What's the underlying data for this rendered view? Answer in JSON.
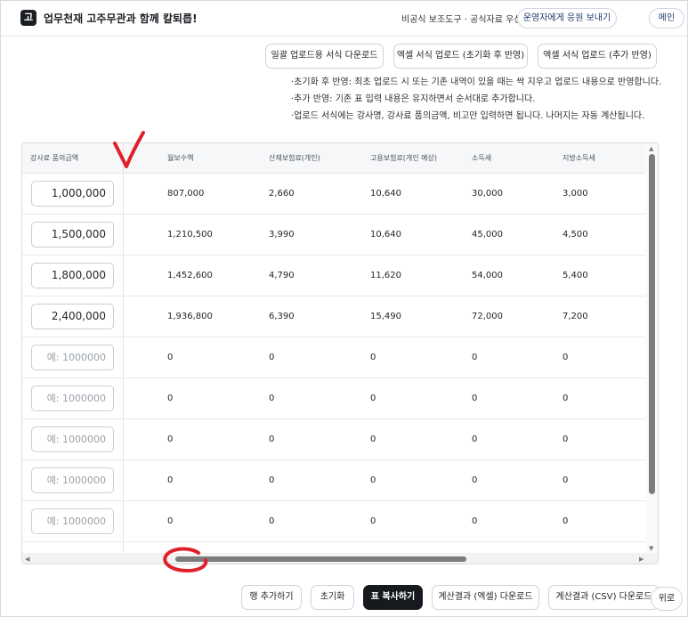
{
  "header": {
    "logo_char": "고",
    "title": "업무천재 고주무관과 함께 칼퇴릅!",
    "notice": "비공식 보조도구 · 공식자료 우선",
    "support_label": "운영자에게 응원 보내기",
    "home_label": "메인"
  },
  "actions": {
    "download_template": "일괄 업로드용 서식 다운로드",
    "excel_upload_reset": "엑셀 서식 업로드 (초기화 후 반영)",
    "excel_upload_append": "엑셀 서식 업로드 (추가 반영)"
  },
  "notes": [
    "·초기화 후 반영: 최초 업로드 시 또는 기존 내역이 있을 때는 싹 지우고 업로드 내용으로 반영합니다.",
    "·추가 반영: 기존 표 입력 내용은 유지하면서 순서대로 추가합니다.",
    "·업로드 서식에는 강사명, 강사료 품의금액, 비고만 입력하면 됩니다. 나머지는 자동 계산됩니다."
  ],
  "table": {
    "columns": [
      "강사료 품의금액",
      "월보수액",
      "산재보험료(개인)",
      "고용보험료(개인 예상)",
      "소득세",
      "지방소득세"
    ],
    "input_placeholder": "예: 1000000",
    "rows": [
      {
        "amount": "1,000,000",
        "cells": [
          "807,000",
          "2,660",
          "10,640",
          "30,000",
          "3,000"
        ]
      },
      {
        "amount": "1,500,000",
        "cells": [
          "1,210,500",
          "3,990",
          "10,640",
          "45,000",
          "4,500"
        ]
      },
      {
        "amount": "1,800,000",
        "cells": [
          "1,452,600",
          "4,790",
          "11,620",
          "54,000",
          "5,400"
        ]
      },
      {
        "amount": "2,400,000",
        "cells": [
          "1,936,800",
          "6,390",
          "15,490",
          "72,000",
          "7,200"
        ]
      },
      {
        "amount": "",
        "cells": [
          "0",
          "0",
          "0",
          "0",
          "0"
        ]
      },
      {
        "amount": "",
        "cells": [
          "0",
          "0",
          "0",
          "0",
          "0"
        ]
      },
      {
        "amount": "",
        "cells": [
          "0",
          "0",
          "0",
          "0",
          "0"
        ]
      },
      {
        "amount": "",
        "cells": [
          "0",
          "0",
          "0",
          "0",
          "0"
        ]
      },
      {
        "amount": "",
        "cells": [
          "0",
          "0",
          "0",
          "0",
          "0"
        ]
      }
    ]
  },
  "toolbar": {
    "add_row": "행 추가하기",
    "reset": "초기화",
    "copy_table": "표 복사하기",
    "download_excel": "계산결과 (엑셀) 다운로드",
    "download_csv": "계산결과 (CSV) 다운로드",
    "scroll_top": "위로"
  },
  "colors": {
    "primary_dark": "#16191d",
    "annotation_red": "#e0202a"
  }
}
